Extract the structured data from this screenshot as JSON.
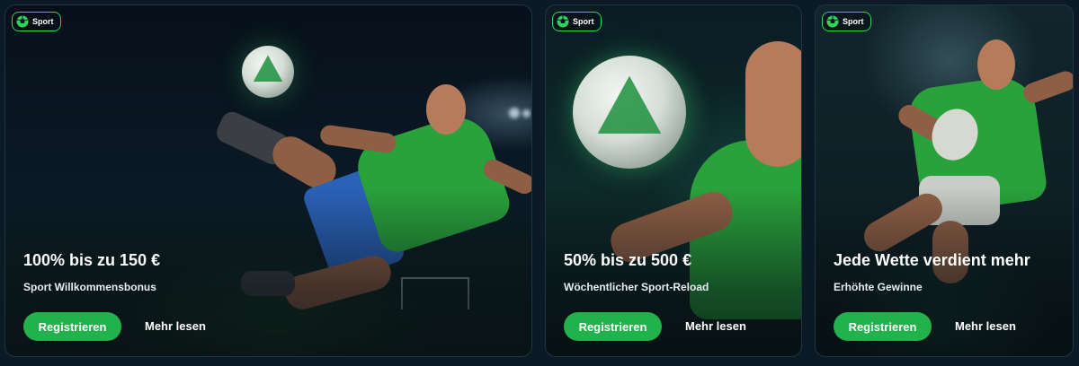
{
  "cards": [
    {
      "badge": {
        "icon": "soccer-ball-icon",
        "label": "Sport"
      },
      "title": "100% bis zu 150 €",
      "subtitle": "Sport Willkommensbonus",
      "register_label": "Registrieren",
      "more_label": "Mehr lesen"
    },
    {
      "badge": {
        "icon": "soccer-ball-icon",
        "label": "Sport"
      },
      "title": "50% bis zu 500 €",
      "subtitle": "Wöchentlicher Sport-Reload",
      "register_label": "Registrieren",
      "more_label": "Mehr lesen"
    },
    {
      "badge": {
        "icon": "soccer-ball-icon",
        "label": "Sport"
      },
      "title": "Jede Wette verdient mehr",
      "subtitle": "Erhöhte Gewinne",
      "register_label": "Registrieren",
      "more_label": "Mehr lesen"
    }
  ],
  "colors": {
    "accent": "#22b24c",
    "badge_border": "#2fd45a",
    "page_background": "#0c1a26"
  }
}
